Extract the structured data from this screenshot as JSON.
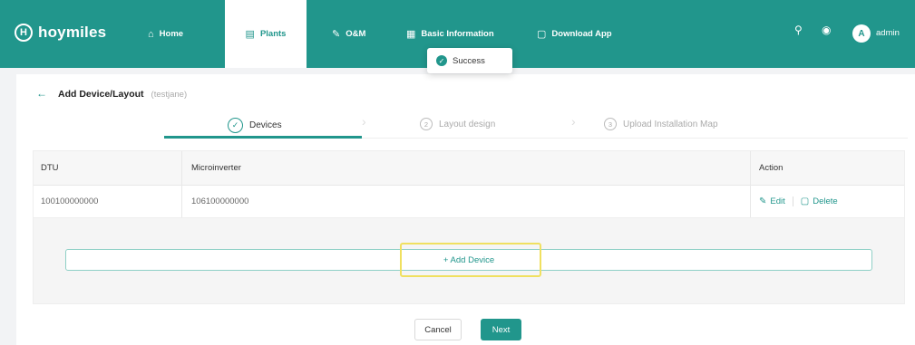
{
  "header": {
    "logo_text": "hoymiles",
    "logo_letter": "H",
    "nav": [
      {
        "label": "Home",
        "icon": "home-icon",
        "glyph": "⌂"
      },
      {
        "label": "Plants",
        "icon": "plants-icon",
        "glyph": "▤"
      },
      {
        "label": "O&M",
        "icon": "wrench-icon",
        "glyph": "✎"
      },
      {
        "label": "Basic Information",
        "icon": "info-list-icon",
        "glyph": "▦"
      },
      {
        "label": "Download App",
        "icon": "download-icon",
        "glyph": "▢"
      }
    ],
    "search_glyph": "⚲",
    "globe_glyph": "◉",
    "avatar_letter": "A",
    "username": "admin"
  },
  "toast": {
    "text": "Success",
    "glyph": "✓"
  },
  "page": {
    "title": "Add Device/Layout",
    "subtitle": "(testjane)",
    "back_glyph": "←"
  },
  "steps": [
    {
      "label": "Devices",
      "num": "✓",
      "state": "active"
    },
    {
      "label": "Layout design",
      "num": "2",
      "state": "pending"
    },
    {
      "label": "Upload Installation Map",
      "num": "3",
      "state": "pending"
    }
  ],
  "step_arrow": "›",
  "table": {
    "headers": [
      "DTU",
      "Microinverter",
      "Action"
    ],
    "rows": [
      {
        "dtu": "100100000000",
        "micro": "106100000000"
      }
    ],
    "edit_label": "Edit",
    "delete_label": "Delete",
    "edit_glyph": "✎",
    "delete_glyph": "▢"
  },
  "add_device_label": "+ Add Device",
  "buttons": {
    "cancel": "Cancel",
    "next": "Next"
  },
  "colors": {
    "brand": "#21968c",
    "highlight": "#f0e060"
  }
}
